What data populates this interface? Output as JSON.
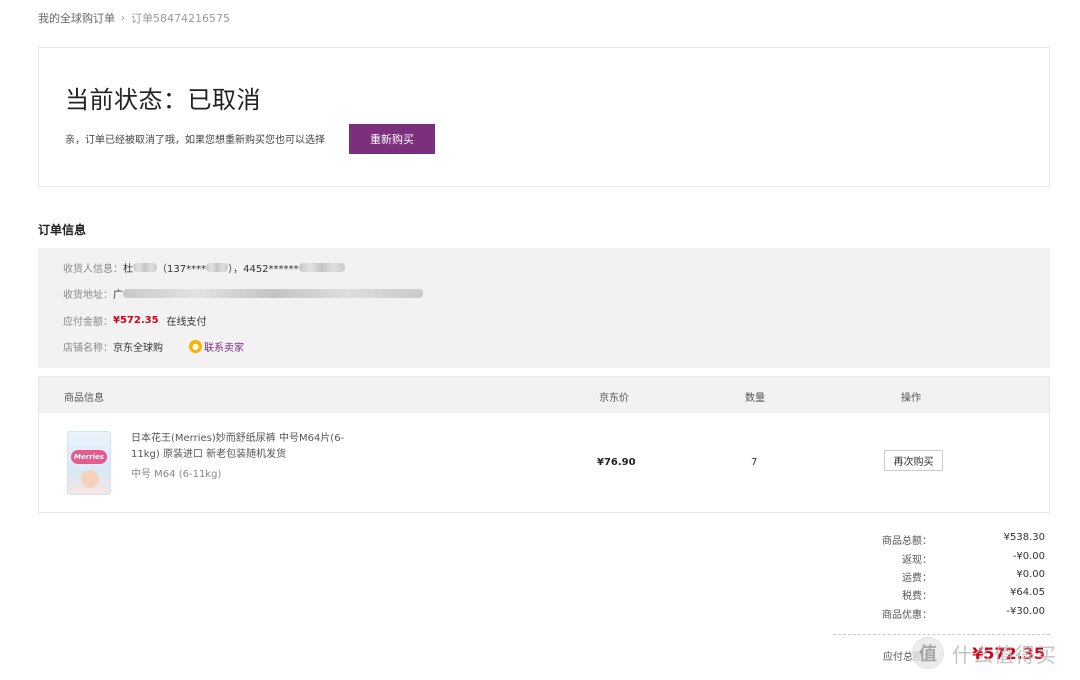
{
  "breadcrumb": {
    "parent": "我的全球购订单",
    "separator": "›",
    "current": "订单58474216575"
  },
  "status": {
    "title": "当前状态：已取消",
    "description": "亲，订单已经被取消了哦，如果您想重新购买您也可以选择",
    "rebuy_label": "重新购买",
    "accent_color": "#7b2f7d"
  },
  "order_info": {
    "section_title": "订单信息",
    "receiver_label": "收货人信息：",
    "receiver_value_a": "杜",
    "receiver_value_b": "（137****",
    "receiver_value_c": "），4452******",
    "address_label": "收货地址：",
    "address_value": "广",
    "amount_label": "应付金额：",
    "amount_value": "¥572.35",
    "payment_method": "在线支付",
    "shop_label": "店铺名称：",
    "shop_value": "京东全球购",
    "contact_label": "联系卖家",
    "price_color": "#d0021b"
  },
  "table": {
    "headers": {
      "product": "商品信息",
      "price": "京东价",
      "quantity": "数量",
      "action": "操作"
    },
    "rows": [
      {
        "name": "日本花王(Merries)妙而舒纸尿裤 中号M64片(6-11kg) 原装进口 新老包装随机发货",
        "spec": "中号 M64 (6-11kg)",
        "brand": "Merries",
        "price": "¥76.90",
        "quantity": "7",
        "action_label": "再次购买"
      }
    ]
  },
  "summary": {
    "rows": [
      {
        "label": "商品总额：",
        "value": "¥538.30"
      },
      {
        "label": "返现：",
        "value": "-¥0.00"
      },
      {
        "label": "运费：",
        "value": "¥0.00"
      },
      {
        "label": "税费：",
        "value": "¥64.05"
      },
      {
        "label": "商品优惠：",
        "value": "-¥30.00"
      }
    ],
    "total_label": "应付总额：",
    "total_value": "¥572.35"
  },
  "watermark": {
    "logo_char": "值",
    "text": "什么值得买"
  }
}
